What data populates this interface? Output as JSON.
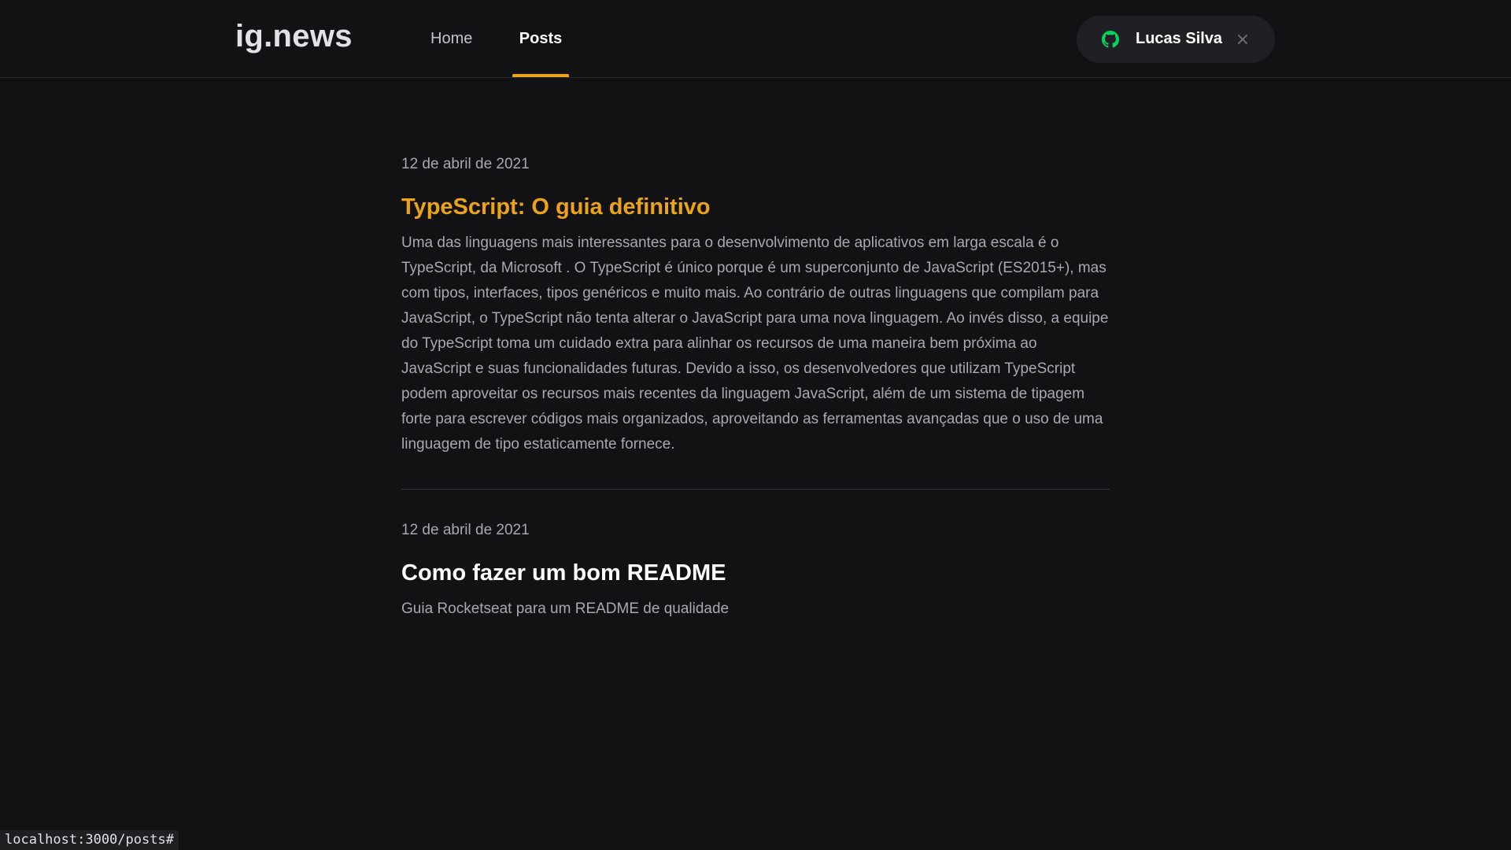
{
  "header": {
    "logo": "ig.news",
    "nav": [
      {
        "label": "Home",
        "active": false
      },
      {
        "label": "Posts",
        "active": true
      }
    ],
    "user": {
      "name": "Lucas Silva",
      "provider_icon": "github-icon",
      "sign_out_icon": "close-icon"
    }
  },
  "posts": [
    {
      "date": "12 de abril de 2021",
      "title": "TypeScript: O guia definitivo",
      "excerpt": "Uma das linguagens mais interessantes para o desenvolvimento de aplicativos em larga escala é o TypeScript, da Microsoft . O TypeScript é único porque é um superconjunto de JavaScript (ES2015+), mas com tipos, interfaces, tipos genéricos e muito mais. Ao contrário de outras linguagens que compilam para JavaScript, o TypeScript não tenta alterar o JavaScript para uma nova linguagem. Ao invés disso, a equipe do TypeScript toma um cuidado extra para alinhar os recursos de uma maneira bem próxima ao JavaScript e suas funcionalidades futuras. Devido a isso, os desenvolvedores que utilizam TypeScript podem aproveitar os recursos mais recentes da linguagem JavaScript, além de um sistema de tipagem forte para escrever códigos mais organizados, aproveitando as ferramentas avançadas que o uso de uma linguagem de tipo estaticamente fornece.",
      "highlighted": true
    },
    {
      "date": "12 de abril de 2021",
      "title": "Como fazer um bom README",
      "excerpt": "Guia Rocketseat para um README de qualidade",
      "highlighted": false
    }
  ],
  "status_bar": {
    "url": "localhost:3000/posts#"
  },
  "colors": {
    "background": "#121214",
    "accent": "#eba417",
    "github": "#04d361",
    "text": "#e1e1e6",
    "muted": "#a8a8b3"
  }
}
